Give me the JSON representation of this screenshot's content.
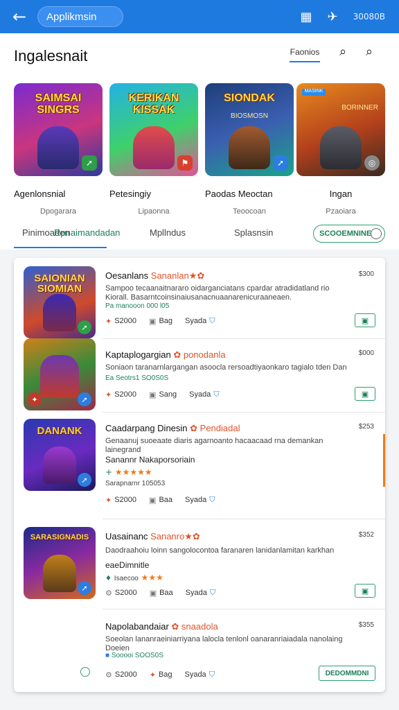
{
  "topbar": {
    "back_icon": "arrow-left-icon",
    "app_label": "Applikmsin",
    "count_label": "30080B",
    "bg": "#1f7ae0"
  },
  "header": {
    "title": "Ingalesnait",
    "favorites_label": "Faonios"
  },
  "featured": [
    {
      "name": "Agenlonsnial",
      "category": "Dpogarara",
      "art_title": "SAIMSAI SINGRS",
      "art_sub": "",
      "badge_icon": "arrow-icon"
    },
    {
      "name": "Petesingiy",
      "category": "Lipaonna",
      "art_title": "KERIKAN KISSAK",
      "art_sub": "",
      "badge_icon": "flag-icon"
    },
    {
      "name": "Paodas Meoctan",
      "category": "Teoocoan",
      "art_title": "SIONDAK",
      "art_sub": "BIOSMOSN",
      "badge_icon": "arrow-icon"
    },
    {
      "name": "Ingan",
      "category": "Pzaoiara",
      "art_title": "",
      "art_sub": "BORINNER",
      "badge_icon": "target-icon",
      "tag": "MASINK"
    }
  ],
  "tabs": {
    "items": [
      "Pinimoaden",
      "Rpnaimandadan",
      "Mpllndus",
      "Splasnsin"
    ],
    "recommend_label": "SCOOEMNINE"
  },
  "list": [
    {
      "title": "Oesanlans",
      "title_hl": "Sananlan★✿",
      "price": "$300",
      "desc": "Sampoo tecaanaitnararo oidarganciatans cpardar atradidatland rio Kiorall. Basarntcoinsinaiusanacnuaanarenicuraaneaen.",
      "meta": "Pa manooon 000 l05",
      "stat1": "S2000",
      "stat2": "Bag",
      "stat3": "Syada",
      "art_title": "SAIONIAN SIOMIAN"
    },
    {
      "title": "Kaptaplogargian",
      "title_hl": "✿ ponodanla",
      "price": "$000",
      "desc": "Soniaon taranarnlargangan asoocla rersoadtiyaonkaro tagialo tden Dan",
      "meta": "Ea Seotrs1 SO0S0S",
      "stat1": "S2000",
      "stat2": "Sang",
      "stat3": "Syada",
      "art_title": ""
    },
    {
      "title": "Caadarpang Dinesin",
      "title_hl": "✿ Pendiadal",
      "price": "$253",
      "desc": "Genaanuj suoeaate diaris agarnoanto hacaacaad rna demankan lainegrand",
      "sub": "Sanannr Nakaporsoriain",
      "stars": "★★★★★",
      "stars_meta": "Sarapnarnr 105053",
      "stat1": "S2000",
      "stat2": "Baa",
      "stat3": "Syada",
      "art_title": "DANANK"
    },
    {
      "title": "Uasainanc",
      "title_hl": "Sananro★✿",
      "price": "$352",
      "desc": "Daodraahoiu loinn sangolocontoa faranaren lanidanlamitan karkhan",
      "sub": "eaeDimnitle",
      "stars": "★★★",
      "stars_meta": "Isaecoo",
      "stat1": "S2000",
      "stat2": "Baa",
      "stat3": "Syada",
      "art_title": "SARASIGNADIS"
    },
    {
      "title": "Napolabandaiar",
      "title_hl": "✿ snaadola",
      "price": "$355",
      "desc": "Soeolan lananraeiniarriyana lalocla tenlonl oanaranriaiadala nanolaing Doeien",
      "meta": "Sooooi SOOS0S",
      "stat1": "S2000",
      "stat2": "Bag",
      "stat3": "Syada",
      "button": "DEDOMMDNI"
    }
  ]
}
